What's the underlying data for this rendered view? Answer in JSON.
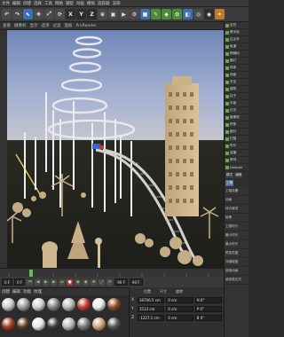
{
  "menu": [
    "文件",
    "编辑",
    "创建",
    "选择",
    "工具",
    "网格",
    "捕捉",
    "动画",
    "模拟",
    "追踪器",
    "渲染"
  ],
  "toolbar": [
    "↶",
    "↷",
    "⬉",
    "✥",
    "⤢",
    "⟳",
    "X",
    "Y",
    "Z",
    "⊕"
  ],
  "viewport": {
    "menu": [
      "查看",
      "摄像机",
      "显示",
      "选项",
      "过滤",
      "面板",
      "ProRender"
    ]
  },
  "object_list": [
    "空白",
    "摩天轮",
    "过山车",
    "轨道",
    "棕榈树",
    "路灯",
    "球体",
    "地面",
    "天空",
    "建筑",
    "柱子",
    "平面",
    "灯光",
    "摄像机",
    "样条",
    "细分",
    "扫描",
    "布尔",
    "克隆",
    "阵列",
    "Umbrell"
  ],
  "attr_tabs": [
    "模式",
    "编辑",
    "用户数据"
  ],
  "attr_tabs2": [
    "工程",
    "工程设置"
  ],
  "attr_props": [
    "工程",
    "工程设置",
    "动画",
    "待办事项",
    "帧率",
    "工程时长",
    "最小时长",
    "最大时长",
    "预览范围",
    "详细程度",
    "使用动画",
    "使用表达式"
  ],
  "timeline": {
    "current": "0 F",
    "end": "90 F",
    "range_end": "90 F",
    "fps_label": "0 F"
  },
  "materials": {
    "menu": [
      "创建",
      "编辑",
      "功能",
      "纹理"
    ],
    "swatches": [
      "#c9c9c9",
      "#9a9a9a",
      "#d0d0d0",
      "#7f7f7f",
      "#b8b8b8",
      "#c0392b",
      "#e8e8e8",
      "#8b4a24",
      "#a23a22",
      "#5a3a22",
      "#e5e5e5",
      "#3a3a3a",
      "#b9b9b9",
      "#777777",
      "#d4a373",
      "#555555"
    ]
  },
  "coords": {
    "headers": [
      "位置",
      "尺寸",
      "旋转"
    ],
    "rows": [
      {
        "axis": "X",
        "pos": "18706.5 cm",
        "size": "0 cm",
        "rot": "H 0°"
      },
      {
        "axis": "Y",
        "pos": "1513 cm",
        "size": "0 cm",
        "rot": "P 0°"
      },
      {
        "axis": "Z",
        "pos": "-1227.1 cm",
        "size": "0 cm",
        "rot": "B 0°"
      }
    ]
  }
}
